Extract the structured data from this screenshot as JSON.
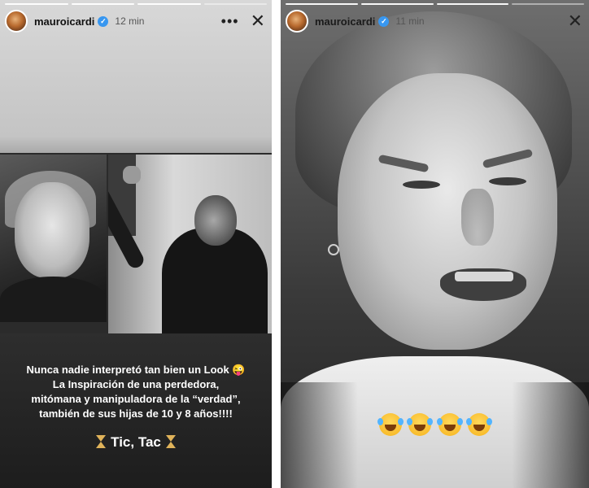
{
  "stories": [
    {
      "username": "mauroicardi",
      "verified_badge": "✓",
      "time": "12 min",
      "more_icon": "•••",
      "close_icon": "✕",
      "caption_lines": [
        "Nunca nadie interpretó tan bien un Look 😜",
        "La Inspiración de una perdedora,",
        "mitómana y manipuladora de la “verdad”,",
        "también de sus hijas de 10 y 8 años!!!!"
      ],
      "tictac": "Tic, Tac"
    },
    {
      "username": "mauroicardi",
      "verified_badge": "✓",
      "time": "11 min",
      "more_icon": "•••",
      "close_icon": "✕"
    }
  ],
  "colors": {
    "verified": "#3897f0",
    "hourglass": "#e0b35a",
    "emoji": "#f6b21c"
  }
}
